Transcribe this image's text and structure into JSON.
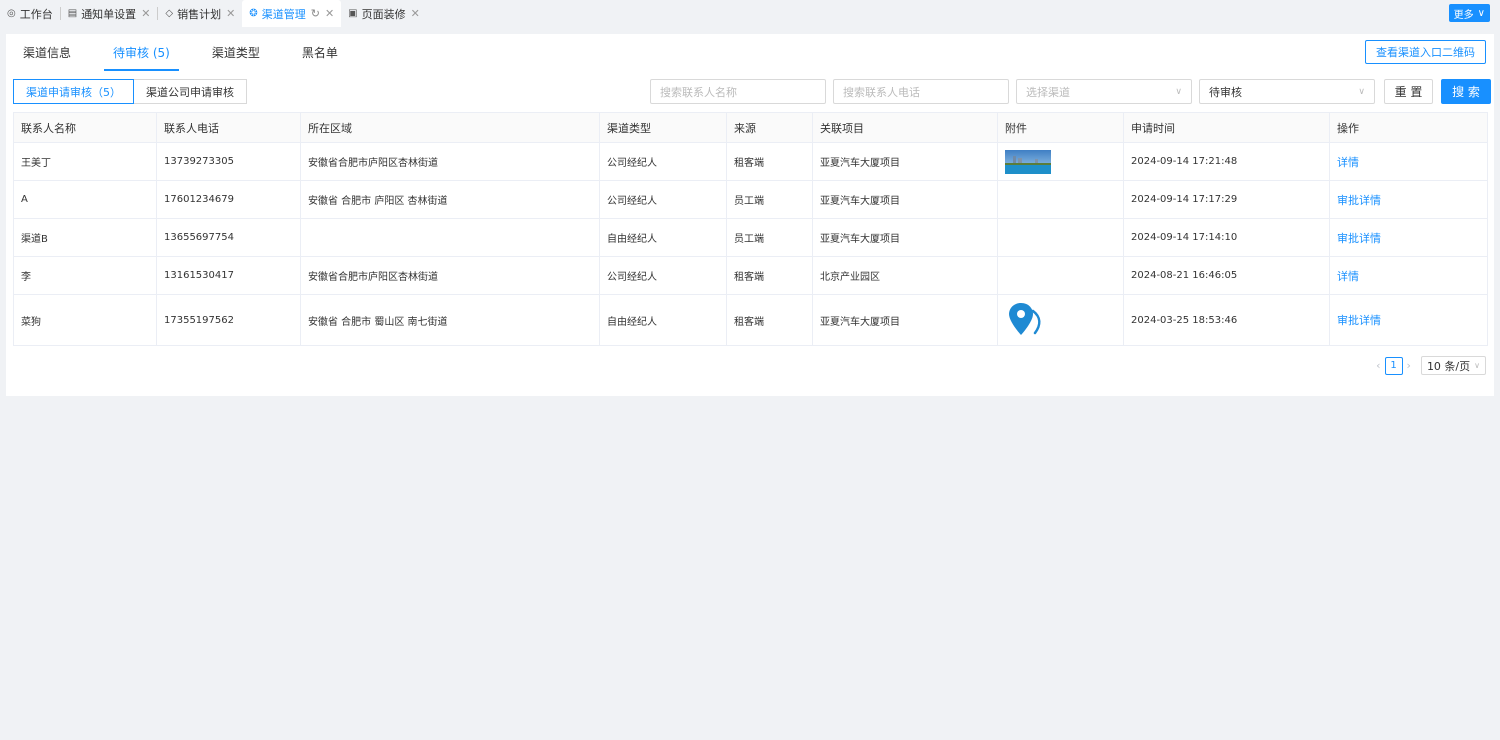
{
  "tabs": [
    {
      "label": "工作台",
      "icon": "dashboard-icon",
      "closable": false
    },
    {
      "label": "通知单设置",
      "icon": "form-icon",
      "closable": true
    },
    {
      "label": "销售计划",
      "icon": "tag-icon",
      "closable": true
    },
    {
      "label": "渠道管理",
      "icon": "settings-icon",
      "closable": true,
      "active": true
    },
    {
      "label": "页面装修",
      "icon": "layout-icon",
      "closable": true
    }
  ],
  "more_label": "更多",
  "subtabs": [
    "渠道信息",
    "待审核 (5)",
    "渠道类型",
    "黑名单"
  ],
  "qr_button": "查看渠道入口二维码",
  "segments": [
    "渠道申请审核（5）",
    "渠道公司申请审核"
  ],
  "filters": {
    "name_placeholder": "搜索联系人名称",
    "phone_placeholder": "搜索联系人电话",
    "channel_placeholder": "选择渠道",
    "status_value": "待审核"
  },
  "reset_label": "重 置",
  "search_label": "搜 索",
  "columns": [
    "联系人名称",
    "联系人电话",
    "所在区域",
    "渠道类型",
    "来源",
    "关联项目",
    "附件",
    "申请时间",
    "操作"
  ],
  "rows": [
    {
      "name": "王美丁",
      "phone": "13739273305",
      "area": "安徽省合肥市庐阳区杏林街道",
      "type": "公司经纪人",
      "source": "租客端",
      "project": "亚夏汽车大厦项目",
      "attachment": "photo",
      "time": "2024-09-14 17:21:48",
      "action": "详情"
    },
    {
      "name": "A",
      "phone": "17601234679",
      "area": "安徽省 合肥市 庐阳区 杏林街道",
      "type": "公司经纪人",
      "source": "员工端",
      "project": "亚夏汽车大厦项目",
      "attachment": "",
      "time": "2024-09-14 17:17:29",
      "action": "审批详情"
    },
    {
      "name": "渠道B",
      "phone": "13655697754",
      "area": "",
      "type": "自由经纪人",
      "source": "员工端",
      "project": "亚夏汽车大厦项目",
      "attachment": "",
      "time": "2024-09-14 17:14:10",
      "action": "审批详情"
    },
    {
      "name": "李",
      "phone": "13161530417",
      "area": "安徽省合肥市庐阳区杏林街道",
      "type": "公司经纪人",
      "source": "租客端",
      "project": "北京产业园区",
      "attachment": "",
      "time": "2024-08-21 16:46:05",
      "action": "详情"
    },
    {
      "name": "菜狗",
      "phone": "17355197562",
      "area": "安徽省 合肥市 蜀山区 南七街道",
      "type": "自由经纪人",
      "source": "租客端",
      "project": "亚夏汽车大厦项目",
      "attachment": "location-pin",
      "time": "2024-03-25 18:53:46",
      "action": "审批详情"
    }
  ],
  "pagination": {
    "current": "1",
    "page_size": "10 条/页"
  },
  "colors": {
    "primary": "#1890ff"
  }
}
